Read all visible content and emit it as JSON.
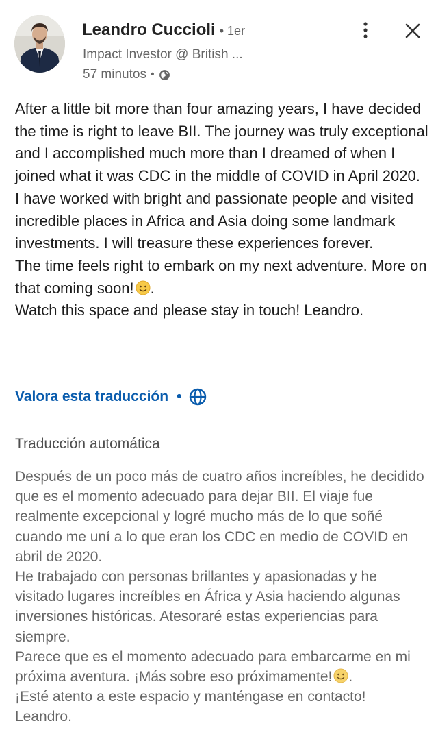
{
  "post": {
    "author_name": "Leandro Cuccioli",
    "connection_degree": "• 1er",
    "headline": "Impact Investor @ British ...",
    "time_ago": "57 minutos",
    "time_separator": "•",
    "visibility_icon": "globe-icon",
    "menu_icon": "more-vertical-icon",
    "close_icon": "close-icon",
    "body": [
      "After a little bit more than four amazing years, I have decided the time is right to leave BII. The journey was truly exceptional and I accomplished much more than I dreamed of when I joined what it was CDC in the middle of COVID in April 2020.",
      "I have worked with bright and passionate people and visited incredible places in Africa and Asia doing some landmark investments. I will treasure these experiences forever.",
      "The time feels right to embark on my next adventure. More on that coming soon!",
      "Watch this space and please stay in touch! Leandro."
    ],
    "emoji_icon": "slightly-smiling-face-emoji"
  },
  "translation": {
    "rate_link": "Valora esta traducción",
    "separator": "•",
    "rate_icon": "globe-icon",
    "label": "Traducción automática",
    "body": [
      "Después de un poco más de cuatro años increíbles, he decidido que es el momento adecuado para dejar BII. El viaje fue realmente excepcional y logré mucho más de lo que soñé cuando me uní a lo que eran los CDC en medio de COVID en abril de 2020.",
      "He trabajado con personas brillantes y apasionadas y he visitado lugares increíbles en África y Asia haciendo algunas inversiones históricas. Atesoraré estas experiencias para siempre.",
      "Parece que es el momento adecuado para embarcarme en mi próxima aventura. ¡Más sobre eso próximamente!",
      "¡Esté atento a este espacio y manténgase en contacto! Leandro."
    ]
  },
  "colors": {
    "link": "#0a5cad",
    "primary_text": "#1e1e1e",
    "secondary_text": "#666666"
  }
}
